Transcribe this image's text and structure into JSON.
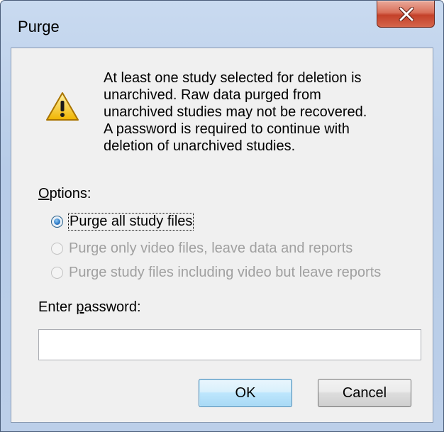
{
  "window": {
    "title": "Purge"
  },
  "message": {
    "lines": [
      "At least one study selected for deletion is",
      "unarchived. Raw data purged from",
      "unarchived studies may not be recovered.",
      "A password is required to continue with",
      "deletion of unarchived studies."
    ],
    "icon": "warning-icon"
  },
  "options": {
    "label_mnemonic": "O",
    "label_rest": "ptions:",
    "items": [
      {
        "label": "Purge all study files",
        "selected": true,
        "enabled": true
      },
      {
        "label": "Purge only video files, leave data and reports",
        "selected": false,
        "enabled": false
      },
      {
        "label": "Purge study files including video but leave reports",
        "selected": false,
        "enabled": false
      }
    ]
  },
  "password": {
    "label_before": "Enter ",
    "label_mnemonic": "p",
    "label_after": "assword:",
    "value": "",
    "placeholder": ""
  },
  "buttons": {
    "ok": "OK",
    "cancel": "Cancel"
  },
  "colors": {
    "title_bar": "#b7cce8",
    "close_button": "#c4412a",
    "dialog_background": "#f0f0f0",
    "ok_button": "#bee6fd",
    "disabled_text": "#a0a0a0"
  }
}
